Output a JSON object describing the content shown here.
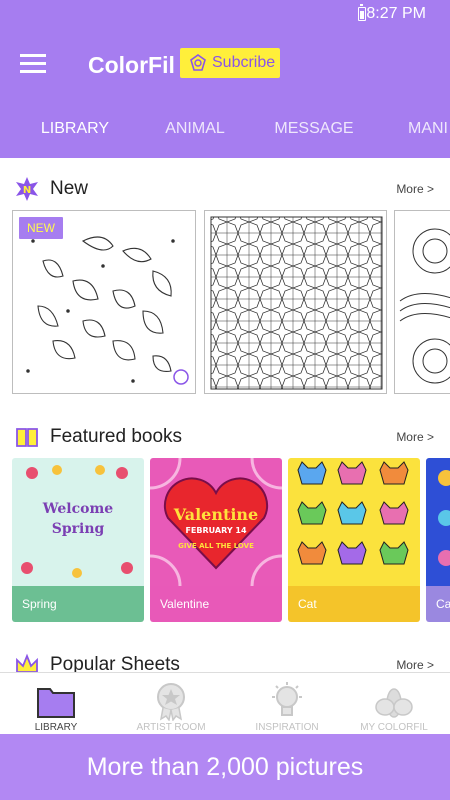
{
  "status_bar": {
    "time": "8:27 PM"
  },
  "app_bar": {
    "title": "ColorFil",
    "subscribe_label": "Subcribe"
  },
  "tabs": [
    {
      "label": "LIBRARY",
      "active": true
    },
    {
      "label": "ANIMAL",
      "active": false
    },
    {
      "label": "MESSAGE",
      "active": false
    },
    {
      "label": "MANI",
      "active": false
    }
  ],
  "sections": {
    "new": {
      "title": "New",
      "more": "More >",
      "badge": "NEW",
      "icon": "new-n-badge-icon"
    },
    "featured": {
      "title": "Featured books",
      "more": "More >",
      "icon": "book-icon"
    },
    "popular": {
      "title": "Popular Sheets",
      "more": "More >",
      "icon": "crown-icon"
    }
  },
  "new_sheets": [
    {
      "name": "seashells",
      "badge": "NEW"
    },
    {
      "name": "star-pattern"
    },
    {
      "name": "flowers"
    }
  ],
  "featured_books": [
    {
      "label": "Spring",
      "art_lines": [
        "Welcome",
        "Spring"
      ],
      "color": "#6cbf93"
    },
    {
      "label": "Valentine",
      "art_lines": [
        "Valentine",
        "FEBRUARY 14",
        "GIVE ALL THE LOVE"
      ],
      "color": "#e859b8"
    },
    {
      "label": "Cat",
      "color": "#f4c42a"
    },
    {
      "label": "Ca",
      "color": "#9a88e0"
    }
  ],
  "bottom_nav": [
    {
      "label": "LIBRARY",
      "icon": "folder-icon",
      "active": true
    },
    {
      "label": "ARTIST ROOM",
      "icon": "star-medal-icon",
      "active": false
    },
    {
      "label": "INSPIRATION",
      "icon": "lightbulb-icon",
      "active": false
    },
    {
      "label": "MY COLORFIL",
      "icon": "lotus-icon",
      "active": false
    }
  ],
  "banner": {
    "text": "More than 2,000 pictures"
  },
  "colors": {
    "primary": "#a67df0",
    "accent": "#ffef3a",
    "banner": "#b288f3"
  }
}
